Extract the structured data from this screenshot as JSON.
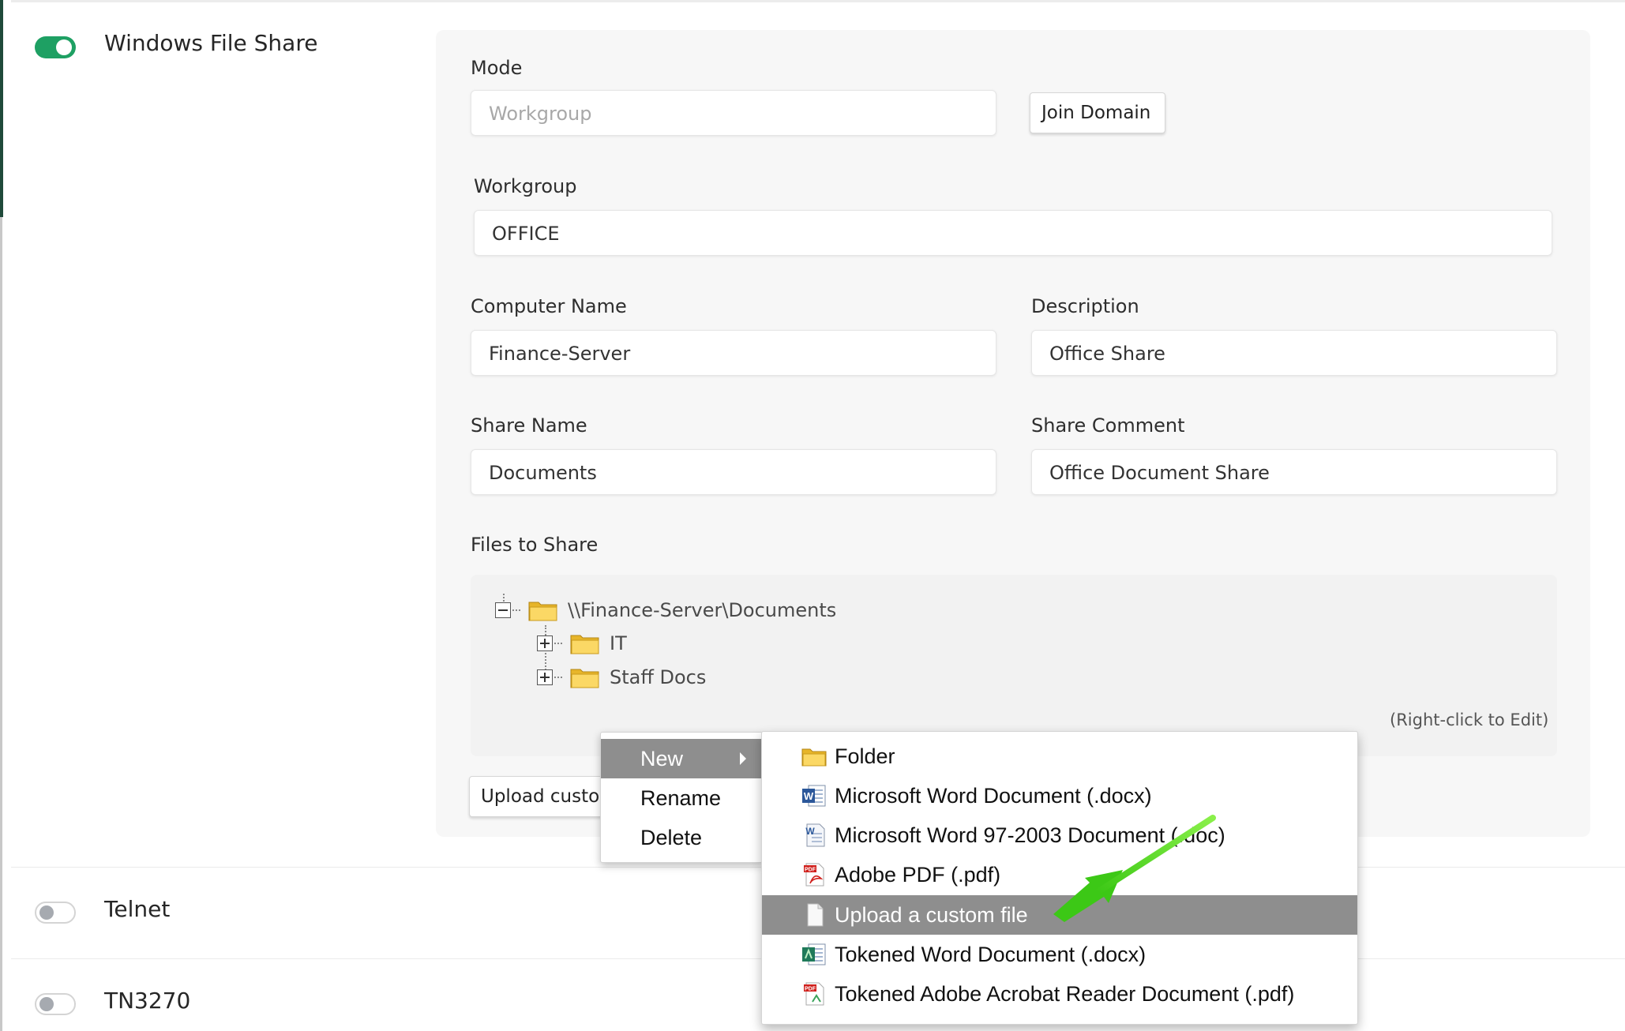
{
  "services": [
    {
      "label": "Windows File Share",
      "enabled": true
    },
    {
      "label": "Telnet",
      "enabled": false
    },
    {
      "label": "TN3270",
      "enabled": false
    }
  ],
  "form": {
    "mode": {
      "label": "Mode",
      "placeholder": "Workgroup",
      "join_button": "Join Domain"
    },
    "workgroup": {
      "label": "Workgroup",
      "value": "OFFICE"
    },
    "computer_name": {
      "label": "Computer Name",
      "value": "Finance-Server"
    },
    "description": {
      "label": "Description",
      "value": "Office Share"
    },
    "share_name": {
      "label": "Share Name",
      "value": "Documents"
    },
    "share_comment": {
      "label": "Share Comment",
      "value": "Office Document Share"
    },
    "files_to_share": {
      "label": "Files to Share",
      "hint": "(Right-click to Edit)"
    },
    "upload_button": "Upload custom file"
  },
  "tree": {
    "root": "\\\\Finance-Server\\Documents",
    "children": [
      "IT",
      "Staff Docs"
    ]
  },
  "context_menu": {
    "items": [
      "New",
      "Rename",
      "Delete"
    ],
    "active": "New"
  },
  "submenu": {
    "items": [
      {
        "label": "Folder",
        "icon": "folder-icon"
      },
      {
        "label": "Microsoft Word Document (.docx)",
        "icon": "word-docx-icon"
      },
      {
        "label": "Microsoft Word 97-2003 Document (.doc)",
        "icon": "word-doc-icon"
      },
      {
        "label": "Adobe PDF (.pdf)",
        "icon": "pdf-icon"
      },
      {
        "label": "Upload a custom file",
        "icon": "blank-file-icon"
      },
      {
        "label": "Tokened Word Document (.docx)",
        "icon": "tokened-word-icon"
      },
      {
        "label": "Tokened Adobe Acrobat Reader Document (.pdf)",
        "icon": "tokened-pdf-icon"
      }
    ],
    "active": "Upload a custom file"
  },
  "colors": {
    "toggle_on": "#1ea063",
    "menu_highlight": "#8e8e8e",
    "pointer_arrow": "#5fd821"
  }
}
